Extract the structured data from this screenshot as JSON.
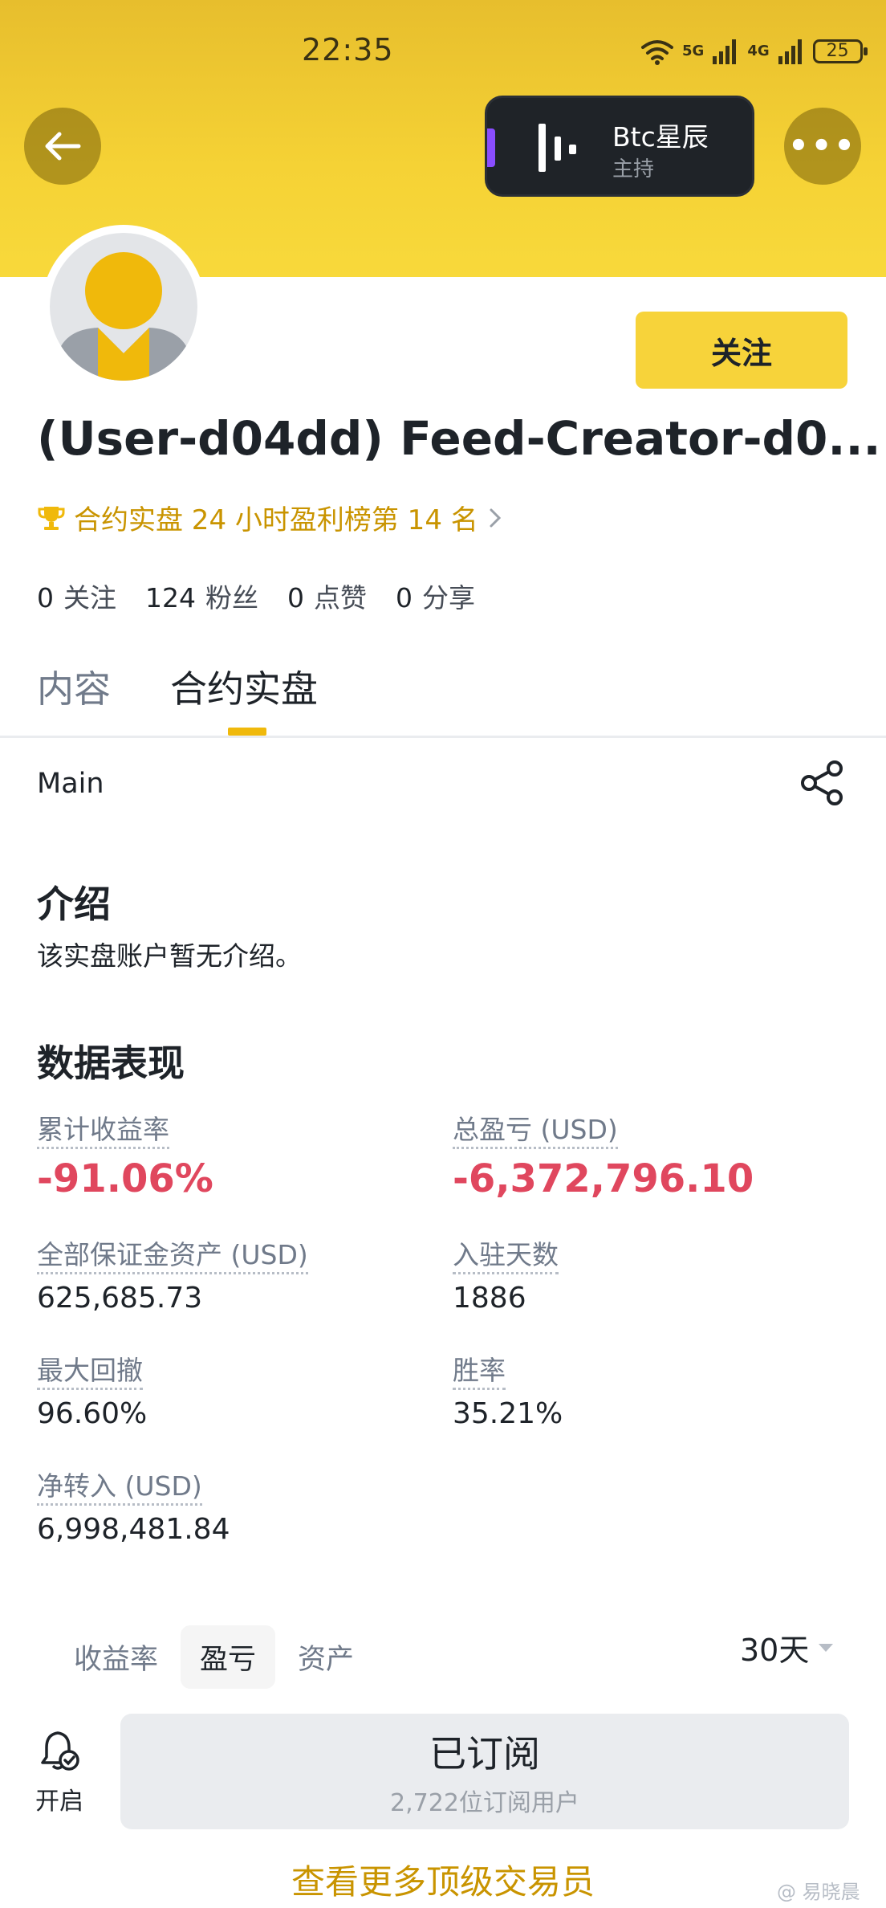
{
  "status_bar": {
    "time": "22:35",
    "net1": "5G",
    "net2": "4G",
    "battery": "25"
  },
  "host": {
    "name": "Btc星辰",
    "role": "主持"
  },
  "profile": {
    "follow_label": "关注",
    "username": "(User-d04dd) Feed-Creator-d0...",
    "rank": "合约实盘 24 小时盈利榜第 14 名",
    "stats": [
      {
        "num": "0",
        "label": "关注"
      },
      {
        "num": "124",
        "label": "粉丝"
      },
      {
        "num": "0",
        "label": "点赞"
      },
      {
        "num": "0",
        "label": "分享"
      }
    ]
  },
  "tabs": {
    "content": "内容",
    "futures": "合约实盘"
  },
  "main_label": "Main",
  "intro": {
    "title": "介绍",
    "text": "该实盘账户暂无介绍。"
  },
  "performance": {
    "title": "数据表现",
    "cumulative_roi": {
      "label": "累计收益率",
      "value": "-91.06%"
    },
    "total_pnl": {
      "label": "总盈亏 (USD)",
      "value": "-6,372,796.10"
    },
    "margin_assets": {
      "label": "全部保证金资产 (USD)",
      "value": "625,685.73"
    },
    "days": {
      "label": "入驻天数",
      "value": "1886"
    },
    "max_drawdown": {
      "label": "最大回撤",
      "value": "96.60%"
    },
    "win_rate": {
      "label": "胜率",
      "value": "35.21%"
    },
    "net_transfer": {
      "label": "净转入 (USD)",
      "value": "6,998,481.84"
    }
  },
  "chart_tabs": [
    "收益率",
    "盈亏",
    "资产"
  ],
  "range": "30天",
  "notify_label": "开启",
  "subscribe": {
    "title": "已订阅",
    "count": "2,722位订阅用户"
  },
  "more_traders": "查看更多顶级交易员",
  "watermark": "@ 易晓晨",
  "colors": {
    "accent": "#f7d33a",
    "negative": "#e0475e",
    "gold_text": "#c99400"
  }
}
